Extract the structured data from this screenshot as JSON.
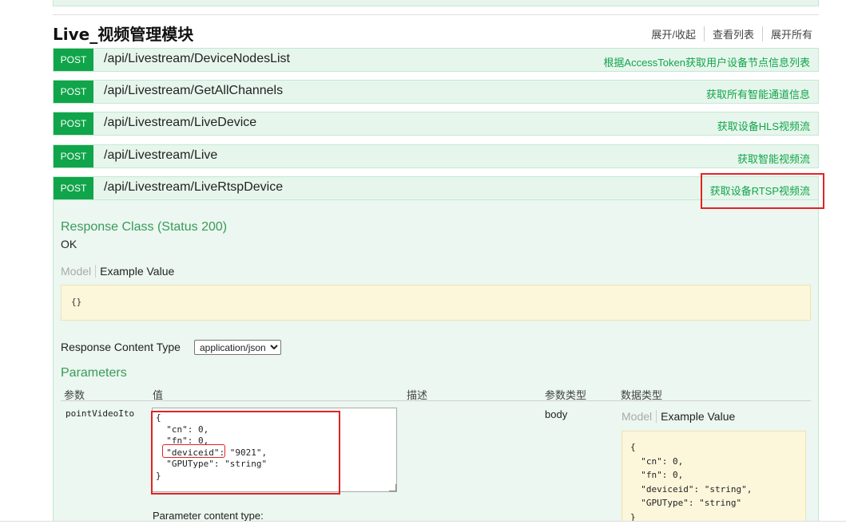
{
  "section": {
    "title": "Live_视频管理模块",
    "actions": [
      "展开/收起",
      "查看列表",
      "展开所有"
    ]
  },
  "endpoints": [
    {
      "method": "POST",
      "path": "/api/Livestream/DeviceNodesList",
      "summary": "根据AccessToken获取用户设备节点信息列表"
    },
    {
      "method": "POST",
      "path": "/api/Livestream/GetAllChannels",
      "summary": "获取所有智能通道信息"
    },
    {
      "method": "POST",
      "path": "/api/Livestream/LiveDevice",
      "summary": "获取设备HLS视频流"
    },
    {
      "method": "POST",
      "path": "/api/Livestream/Live",
      "summary": "获取智能视频流"
    },
    {
      "method": "POST",
      "path": "/api/Livestream/LiveRtspDevice",
      "summary": "获取设备RTSP视频流"
    }
  ],
  "operation": {
    "response_class_title": "Response Class (Status 200)",
    "response_status_text": "OK",
    "model_tab": "Model",
    "example_tab": "Example Value",
    "response_example": "{}",
    "response_content_type_label": "Response Content Type",
    "response_content_type_value": "application/json",
    "parameters_title": "Parameters",
    "param_headers": {
      "name": "参数",
      "value": "值",
      "description": "描述",
      "param_type": "参数类型",
      "data_type": "数据类型"
    },
    "param": {
      "name": "pointVideoIto",
      "value": "{\n  \"cn\": 0,\n  \"fn\": 0,\n  \"deviceid\": \"9021\",\n  \"GPUType\": \"string\"\n}",
      "param_type": "body",
      "model_tab": "Model",
      "example_tab": "Example Value",
      "schema_example": "{\n  \"cn\": 0,\n  \"fn\": 0,\n  \"deviceid\": \"string\",\n  \"GPUType\": \"string\"\n}"
    },
    "parameter_content_type_label": "Parameter content type:"
  },
  "colors": {
    "post_green": "#10a54a",
    "row_bg": "#e7f6ec",
    "highlight_red": "#e02424"
  }
}
